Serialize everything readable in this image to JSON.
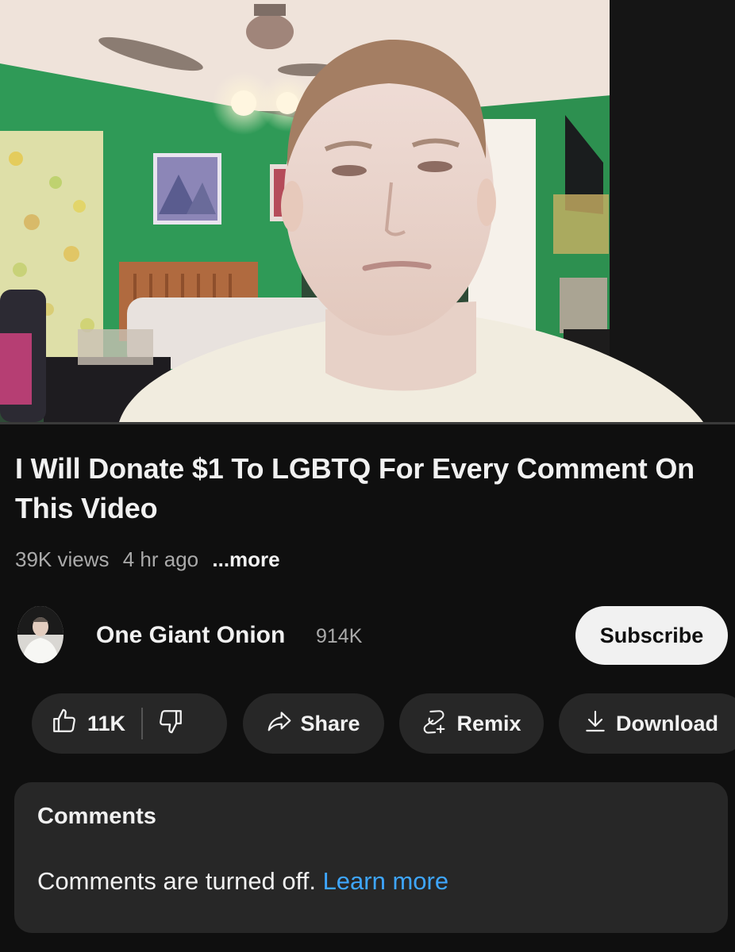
{
  "video": {
    "title": "I Will Donate $1 To LGBTQ For Every Comment On This Video",
    "views": "39K views",
    "age": "4 hr ago",
    "more_label": "...more"
  },
  "channel": {
    "name": "One Giant Onion",
    "subscribers": "914K",
    "subscribe_label": "Subscribe"
  },
  "actions": {
    "likes": "11K",
    "share_label": "Share",
    "remix_label": "Remix",
    "download_label": "Download"
  },
  "comments": {
    "title": "Comments",
    "notice": "Comments are turned off.",
    "learn_more": "Learn more"
  },
  "icons": {
    "like": "thumbs-up-icon",
    "dislike": "thumbs-down-icon",
    "share": "share-arrow-icon",
    "remix": "remix-icon",
    "download": "download-icon"
  },
  "colors": {
    "background": "#0f0f0f",
    "pill": "#272727",
    "link": "#3ea6ff",
    "subscribe_bg": "#f1f1f1"
  }
}
